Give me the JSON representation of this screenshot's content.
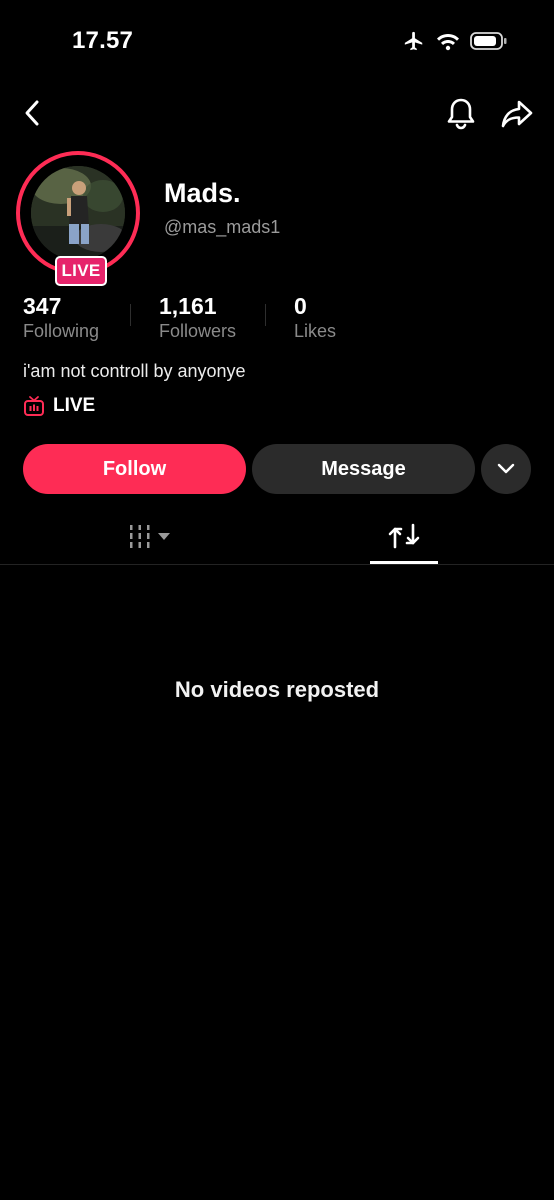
{
  "status_bar": {
    "time": "17.57",
    "icons": [
      "airplane-icon",
      "wifi-icon",
      "battery-icon"
    ]
  },
  "nav": {
    "back_icon": "back-chevron-icon",
    "bell_icon": "bell-icon",
    "share_icon": "share-arrow-icon"
  },
  "profile": {
    "name": "Mads.",
    "handle": "@mas_mads1",
    "live_badge": "LIVE",
    "bio": "i'am not controll by anyonye"
  },
  "stats": [
    {
      "value": "347",
      "label": "Following"
    },
    {
      "value": "1,161",
      "label": "Followers"
    },
    {
      "value": "0",
      "label": "Likes"
    }
  ],
  "live_link": {
    "label": "LIVE",
    "icon": "tv-live-icon"
  },
  "actions": {
    "follow": "Follow",
    "message": "Message",
    "more_icon": "chevron-down-icon"
  },
  "tabs": {
    "videos_icon": "grid-columns-icon",
    "reposts_icon": "repost-icon",
    "active": "reposts"
  },
  "empty_state": {
    "text": "No videos reposted"
  },
  "colors": {
    "accent": "#fe2c55",
    "live_badge": "#e6246b",
    "background": "#000000",
    "secondary_button": "#2b2b2b"
  }
}
